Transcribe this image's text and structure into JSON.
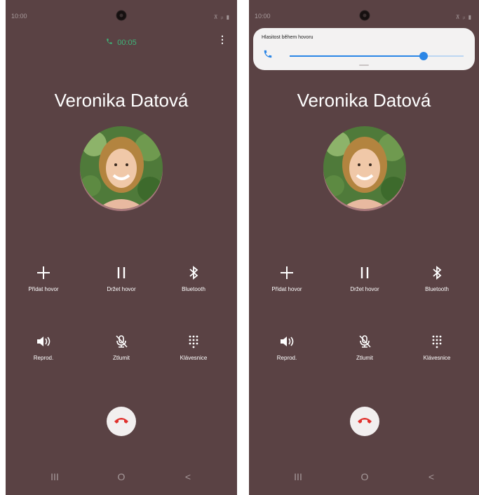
{
  "screens": [
    {
      "status": {
        "time": "10:00",
        "icons": "⊼ ᵢₗ ▮"
      },
      "call_timer": "00:05",
      "menu_icon": "more-vertical-icon",
      "contact_name": "Veronika Datová",
      "actions": [
        {
          "label": "Přidat hovor",
          "icon": "plus-icon"
        },
        {
          "label": "Držet hovor",
          "icon": "pause-icon"
        },
        {
          "label": "Bluetooth",
          "icon": "bluetooth-icon"
        },
        {
          "label": "Reprod.",
          "icon": "speaker-icon"
        },
        {
          "label": "Ztlumit",
          "icon": "mute-mic-icon"
        },
        {
          "label": "Klávesnice",
          "icon": "keypad-icon"
        }
      ],
      "end_call_icon": "end-call-icon",
      "nav": [
        "III",
        "O",
        "<"
      ]
    },
    {
      "status": {
        "time": "10:00",
        "icons": "⊼ ᵢₗ ▮"
      },
      "volume_panel": {
        "title": "Hlasitost během hovoru",
        "level": 0.77
      },
      "contact_name": "Veronika Datová",
      "actions": [
        {
          "label": "Přidat hovor",
          "icon": "plus-icon"
        },
        {
          "label": "Držet hovor",
          "icon": "pause-icon"
        },
        {
          "label": "Bluetooth",
          "icon": "bluetooth-icon"
        },
        {
          "label": "Reprod.",
          "icon": "speaker-icon"
        },
        {
          "label": "Ztlumit",
          "icon": "mute-mic-icon"
        },
        {
          "label": "Klávesnice",
          "icon": "keypad-icon"
        }
      ],
      "end_call_icon": "end-call-icon",
      "nav": [
        "III",
        "O",
        "<"
      ]
    }
  ],
  "colors": {
    "background": "#5a4244",
    "timer_green": "#3eb67a",
    "end_call_red": "#e0302c",
    "volume_blue": "#2b86e6",
    "panel_bg": "#f3f2f2"
  }
}
